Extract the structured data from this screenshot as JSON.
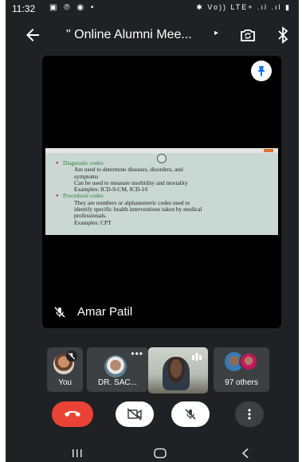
{
  "status_bar": {
    "time": "11:32",
    "left_icons": "▣ ℗ ◉ •",
    "right_icons": "✱ Vo)) LTE+ .ıl .ıl ▮"
  },
  "app_bar": {
    "title": "\" Online Alumni Mee...",
    "title_caret": "▸"
  },
  "main_tile": {
    "presenter_name": "Amar Patil",
    "slide": {
      "lines": [
        {
          "text": "Diagnostic codes",
          "kind": "heading"
        },
        {
          "text": "Are used to determine diseases, disorders, and",
          "kind": "sub"
        },
        {
          "text": "symptoms",
          "kind": "sub"
        },
        {
          "text": "Can be used to measure morbidity and mortality",
          "kind": "sub"
        },
        {
          "text": "Examples: ICD-9-CM, ICD-10",
          "kind": "sub"
        },
        {
          "text": "Procedural codes",
          "kind": "heading"
        },
        {
          "text": "They are numbers or alphanumeric codes used to",
          "kind": "sub"
        },
        {
          "text": "identify specific health interventions taken by medical",
          "kind": "sub"
        },
        {
          "text": "professionals.",
          "kind": "sub"
        },
        {
          "text": "Examples: CPT",
          "kind": "sub"
        }
      ]
    }
  },
  "participants": {
    "you_label": "You",
    "second_label": "DR. SAC...",
    "more_dots": "•••",
    "others_label": "97 others"
  },
  "colors": {
    "end_call": "#ea4335",
    "background": "#202124",
    "tile": "#3c4043",
    "slide_heading": "#2f7d3a"
  },
  "icons": {
    "back": "arrow-left-icon",
    "switch_camera": "switch-camera-icon",
    "bluetooth": "bluetooth-icon",
    "pin": "pin-icon",
    "mic_off": "mic-off-icon",
    "video_off": "video-off-icon",
    "hang_up": "hang-up-icon",
    "more": "more-vert-icon"
  }
}
